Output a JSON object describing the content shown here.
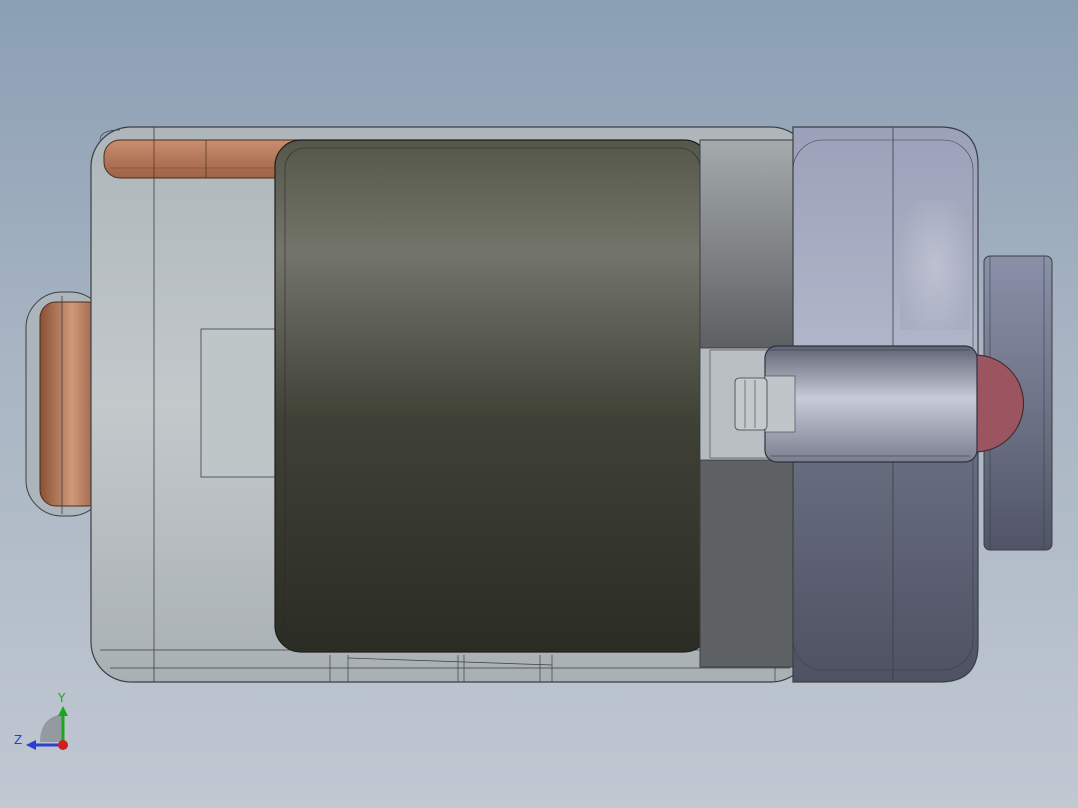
{
  "viewport": {
    "colors": {
      "background_top": "#8b9fb4",
      "background_bottom": "#c0c8d2",
      "housing": "#b5bcc0",
      "motor_body": "#4a4c42",
      "copper": "#b07a5a",
      "end_cap": "#9aa0b8",
      "shaft": "#aab0c0",
      "indicator": "#a05a60"
    },
    "triad": {
      "y_label": "Y",
      "z_label": "Z",
      "y_color": "#1fa51f",
      "z_color": "#2a3fd0",
      "x_color": "#d01f1f"
    }
  }
}
